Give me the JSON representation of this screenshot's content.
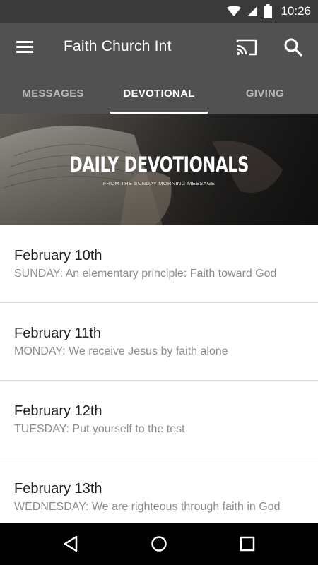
{
  "status_bar": {
    "time": "10:26"
  },
  "app_bar": {
    "title": "Faith Church Int"
  },
  "tabs": [
    {
      "label": "MESSAGES",
      "active": false
    },
    {
      "label": "DEVOTIONAL",
      "active": true
    },
    {
      "label": "GIVING",
      "active": false
    }
  ],
  "banner": {
    "title": "DAILY DEVOTIONALS",
    "subtitle": "FROM THE SUNDAY MORNING MESSAGE"
  },
  "devotionals": [
    {
      "date": "February 10th",
      "description": "SUNDAY: An elementary principle: Faith toward God"
    },
    {
      "date": "February 11th",
      "description": "MONDAY: We receive Jesus by faith alone"
    },
    {
      "date": "February 12th",
      "description": "TUESDAY: Put yourself to the test"
    },
    {
      "date": "February 13th",
      "description": "WEDNESDAY: We are righteous through faith in God"
    }
  ],
  "colors": {
    "status_bar": "#3a3a3a",
    "app_bar": "#515151",
    "tab_inactive": "#b8b8b8",
    "tab_active": "#ffffff",
    "date_text": "#1f1f1f",
    "description_text": "#8c8c8c"
  },
  "icons": [
    "wifi-icon",
    "signal-icon",
    "battery-icon",
    "menu-icon",
    "cast-icon",
    "search-icon",
    "back-icon",
    "home-icon",
    "recents-icon"
  ]
}
